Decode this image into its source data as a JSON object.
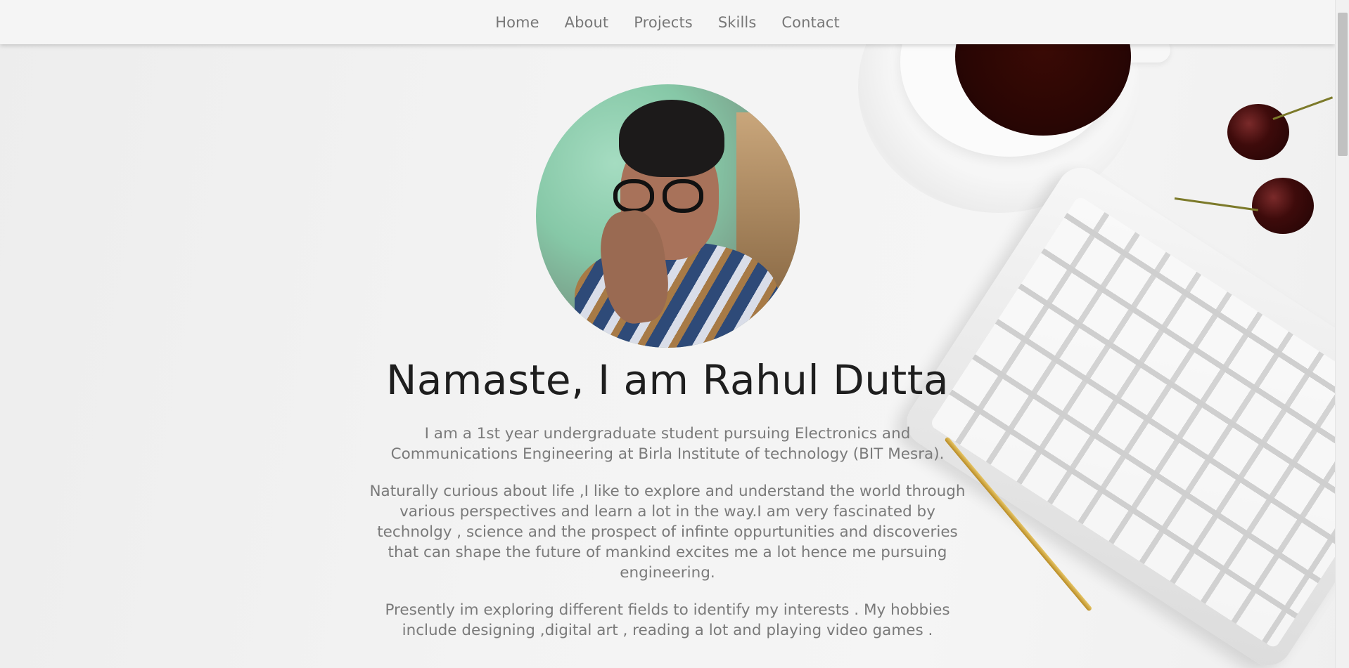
{
  "nav": {
    "items": [
      {
        "label": "Home"
      },
      {
        "label": "About"
      },
      {
        "label": "Projects"
      },
      {
        "label": "Skills"
      },
      {
        "label": "Contact"
      }
    ]
  },
  "hero": {
    "title": "Namaste, I am Rahul Dutta",
    "paragraphs": [
      "I am a 1st year undergraduate student pursuing Electronics and Communications Engineering at Birla Institute of technology (BIT Mesra).",
      "Naturally curious about life ,I like to explore and understand the world through various perspectives and learn a lot in the way.I am very fascinated by technolgy , science and the prospect of infinte oppurtunities and discoveries that can shape the future of mankind excites me a lot hence me pursuing engineering.",
      "Presently im exploring different fields to identify my interests . My hobbies include designing ,digital art , reading a lot and playing video games ."
    ]
  },
  "colors": {
    "nav_text": "#777777",
    "title_text": "#1e1e1e",
    "body_text": "#7a7a7a",
    "background": "#f2f2f2"
  }
}
